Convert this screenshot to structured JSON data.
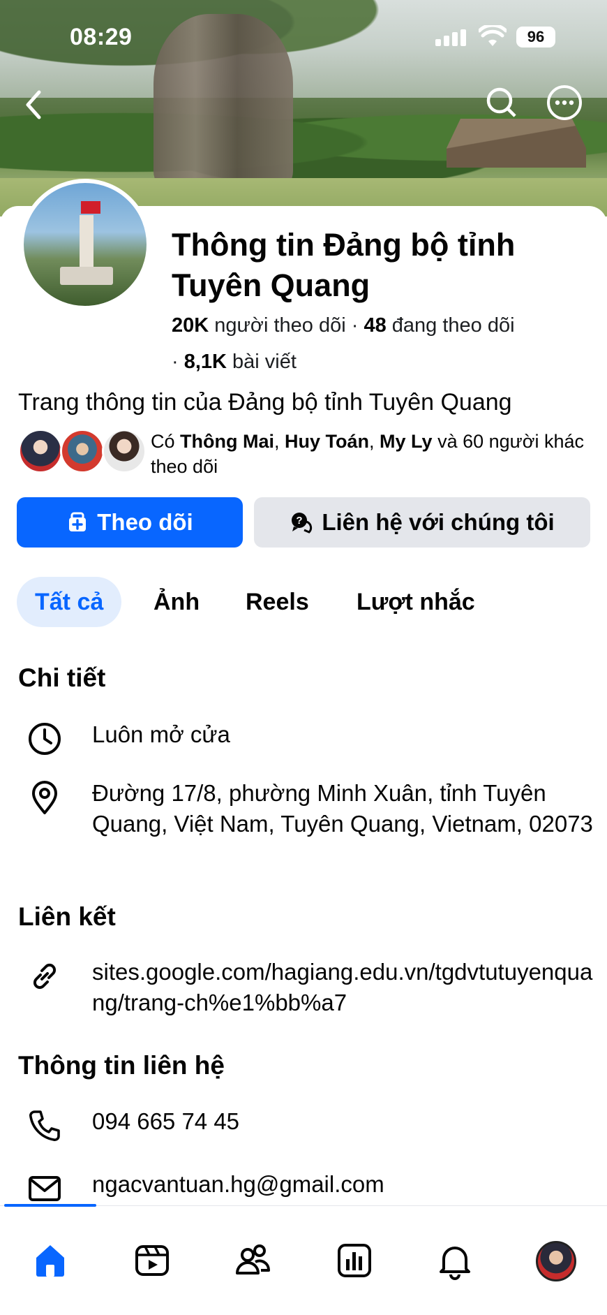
{
  "status_bar": {
    "time": "08:29",
    "battery": "96"
  },
  "page": {
    "name": "Thông tin Đảng bộ tỉnh Tuyên Quang",
    "followers_count": "20K",
    "followers_label": "người theo dõi",
    "following_count": "48",
    "following_label": "đang theo dõi",
    "posts_count": "8,1K",
    "posts_label": "bài viết",
    "description": "Trang thông tin của Đảng bộ tỉnh Tuyên Quang"
  },
  "friends_following": {
    "prefix": "Có",
    "names": [
      "Thông Mai",
      "Huy Toán",
      "My Ly"
    ],
    "suffix": "và 60 người khác theo dõi"
  },
  "actions": {
    "follow_label": "Theo dõi",
    "contact_label": "Liên hệ với chúng tôi"
  },
  "tabs": [
    {
      "label": "Tất cả",
      "active": true
    },
    {
      "label": "Ảnh",
      "active": false
    },
    {
      "label": "Reels",
      "active": false
    },
    {
      "label": "Lượt nhắc",
      "active": false
    }
  ],
  "details": {
    "title": "Chi tiết",
    "hours": "Luôn mở cửa",
    "address": "Đường 17/8, phường Minh Xuân, tỉnh Tuyên Quang, Việt Nam, Tuyên Quang, Vietnam, 02073"
  },
  "links": {
    "title": "Liên kết",
    "website": "sites.google.com/hagiang.edu.vn/tgdvtutuyenquang/trang-ch%e1%bb%a7"
  },
  "contact": {
    "title": "Thông tin liên hệ",
    "phone": "094 665 74 45",
    "email": "ngacvantuan.hg@gmail.com"
  },
  "icons": {
    "back": "chevron-left-icon",
    "search": "search-icon",
    "more": "more-icon",
    "clock": "clock-icon",
    "location": "location-pin-icon",
    "link": "link-icon",
    "phone": "phone-icon",
    "mail": "mail-icon"
  },
  "colors": {
    "accent": "#0866ff",
    "tab_active_bg": "#e2edfd",
    "secondary_button": "#e4e6eb"
  }
}
